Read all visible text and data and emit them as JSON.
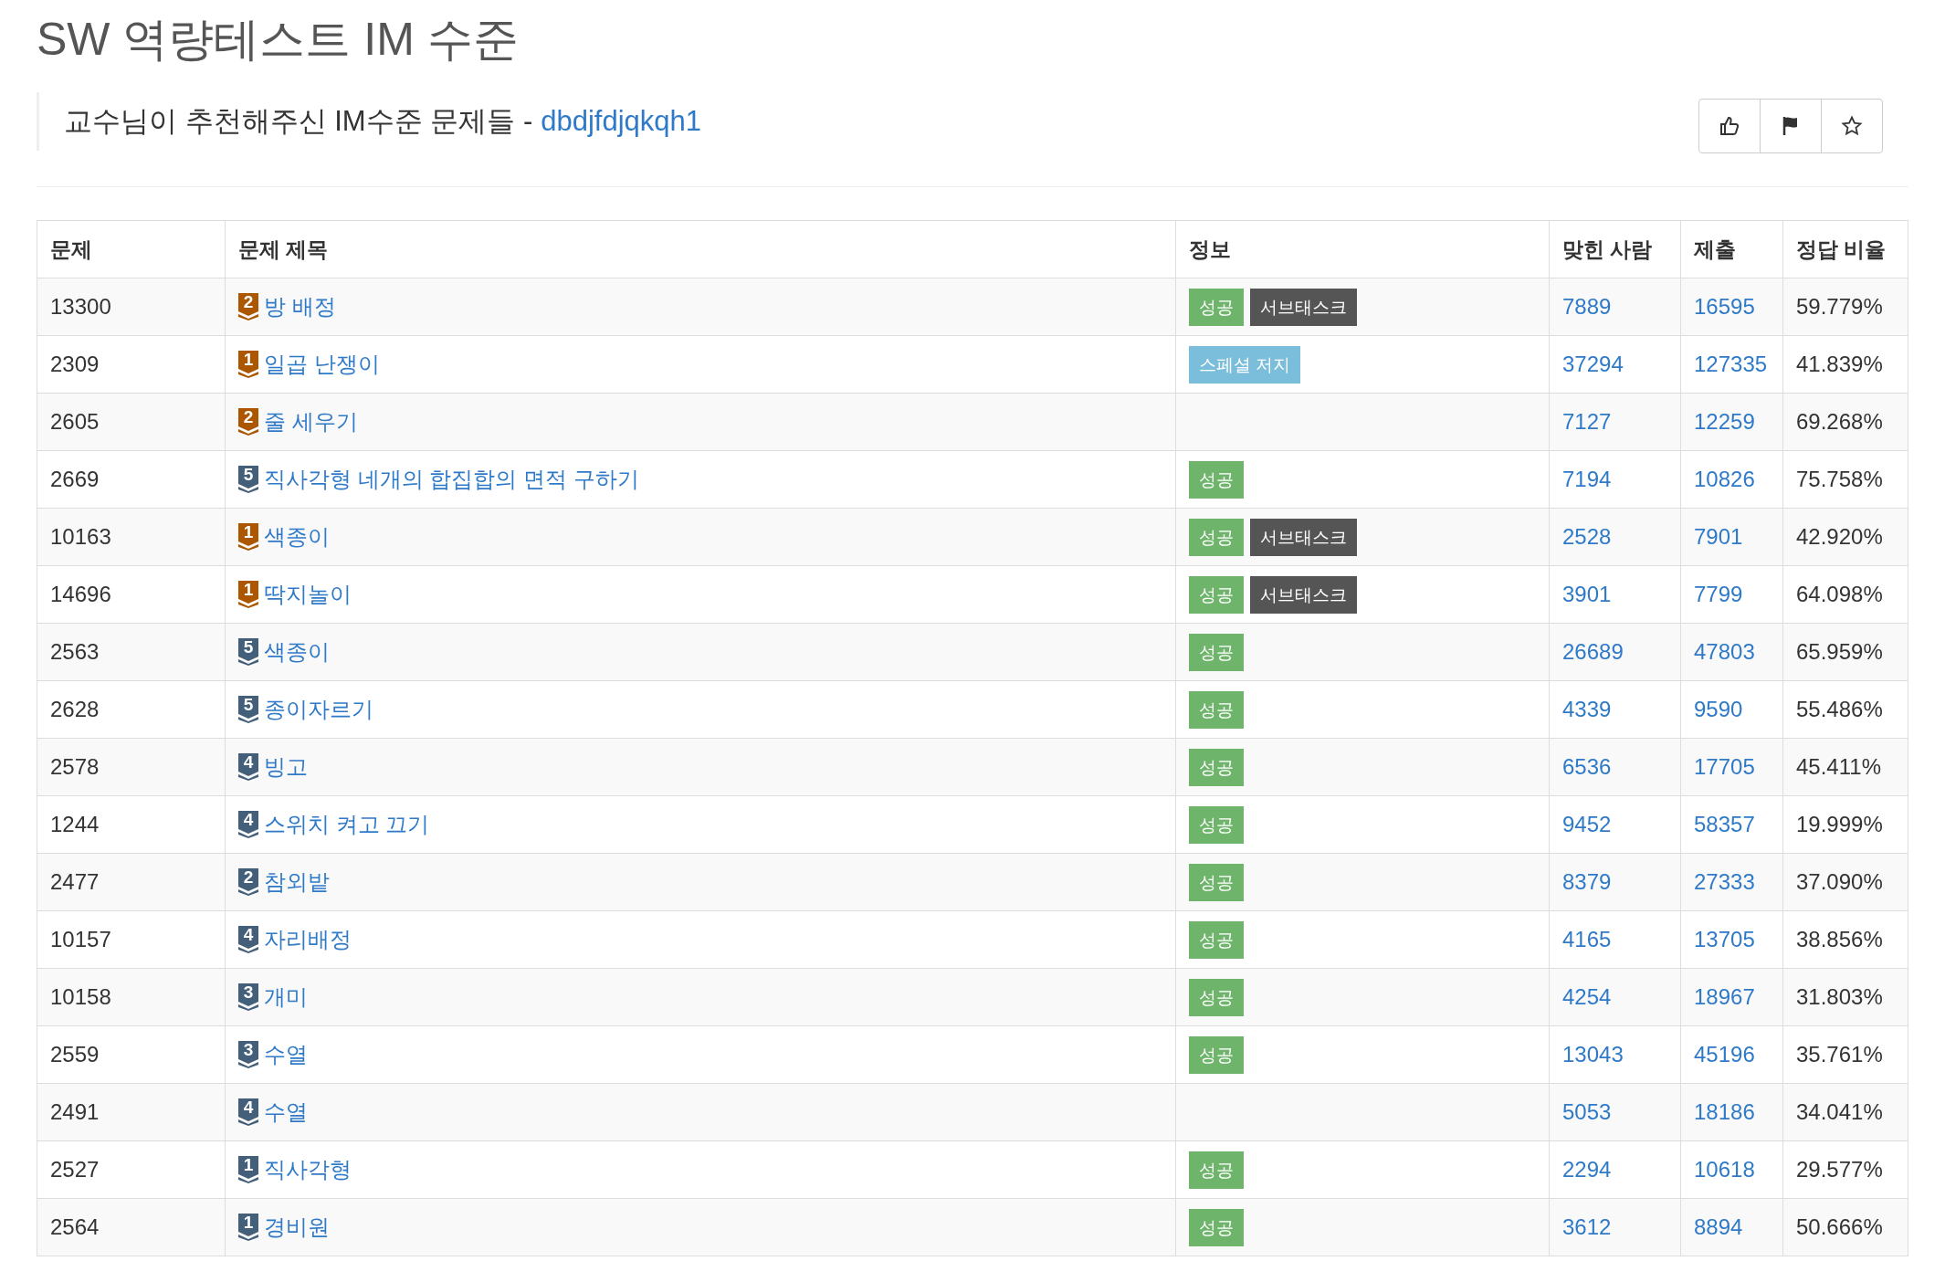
{
  "page": {
    "title": "SW 역량테스트 IM 수준",
    "description": "교수님이 추천해주신 IM수준 문제들 -",
    "author": "dbdjfdjqkqh1"
  },
  "table": {
    "columns": [
      "문제",
      "문제 제목",
      "정보",
      "맞힌 사람",
      "제출",
      "정답 비율"
    ],
    "rows": [
      {
        "id": "13300",
        "tier": "2",
        "color": "#ad5600",
        "title": "방 배정",
        "tags": [
          {
            "kind": "solved",
            "label": "성공"
          },
          {
            "kind": "subtask",
            "label": "서브태스크"
          }
        ],
        "solvers": "7889",
        "submissions": "16595",
        "ratio": "59.779%"
      },
      {
        "id": "2309",
        "tier": "1",
        "color": "#ad5600",
        "title": "일곱 난쟁이",
        "tags": [
          {
            "kind": "special",
            "label": "스페셜 저지"
          }
        ],
        "solvers": "37294",
        "submissions": "127335",
        "ratio": "41.839%"
      },
      {
        "id": "2605",
        "tier": "2",
        "color": "#ad5600",
        "title": "줄 세우기",
        "tags": [],
        "solvers": "7127",
        "submissions": "12259",
        "ratio": "69.268%"
      },
      {
        "id": "2669",
        "tier": "5",
        "color": "#435f7a",
        "title": "직사각형 네개의 합집합의 면적 구하기",
        "tags": [
          {
            "kind": "solved",
            "label": "성공"
          }
        ],
        "solvers": "7194",
        "submissions": "10826",
        "ratio": "75.758%"
      },
      {
        "id": "10163",
        "tier": "1",
        "color": "#ad5600",
        "title": "색종이",
        "tags": [
          {
            "kind": "solved",
            "label": "성공"
          },
          {
            "kind": "subtask",
            "label": "서브태스크"
          }
        ],
        "solvers": "2528",
        "submissions": "7901",
        "ratio": "42.920%"
      },
      {
        "id": "14696",
        "tier": "1",
        "color": "#ad5600",
        "title": "딱지놀이",
        "tags": [
          {
            "kind": "solved",
            "label": "성공"
          },
          {
            "kind": "subtask",
            "label": "서브태스크"
          }
        ],
        "solvers": "3901",
        "submissions": "7799",
        "ratio": "64.098%"
      },
      {
        "id": "2563",
        "tier": "5",
        "color": "#435f7a",
        "title": "색종이",
        "tags": [
          {
            "kind": "solved",
            "label": "성공"
          }
        ],
        "solvers": "26689",
        "submissions": "47803",
        "ratio": "65.959%"
      },
      {
        "id": "2628",
        "tier": "5",
        "color": "#435f7a",
        "title": "종이자르기",
        "tags": [
          {
            "kind": "solved",
            "label": "성공"
          }
        ],
        "solvers": "4339",
        "submissions": "9590",
        "ratio": "55.486%"
      },
      {
        "id": "2578",
        "tier": "4",
        "color": "#435f7a",
        "title": "빙고",
        "tags": [
          {
            "kind": "solved",
            "label": "성공"
          }
        ],
        "solvers": "6536",
        "submissions": "17705",
        "ratio": "45.411%"
      },
      {
        "id": "1244",
        "tier": "4",
        "color": "#435f7a",
        "title": "스위치 켜고 끄기",
        "tags": [
          {
            "kind": "solved",
            "label": "성공"
          }
        ],
        "solvers": "9452",
        "submissions": "58357",
        "ratio": "19.999%"
      },
      {
        "id": "2477",
        "tier": "2",
        "color": "#435f7a",
        "title": "참외밭",
        "tags": [
          {
            "kind": "solved",
            "label": "성공"
          }
        ],
        "solvers": "8379",
        "submissions": "27333",
        "ratio": "37.090%"
      },
      {
        "id": "10157",
        "tier": "4",
        "color": "#435f7a",
        "title": "자리배정",
        "tags": [
          {
            "kind": "solved",
            "label": "성공"
          }
        ],
        "solvers": "4165",
        "submissions": "13705",
        "ratio": "38.856%"
      },
      {
        "id": "10158",
        "tier": "3",
        "color": "#435f7a",
        "title": "개미",
        "tags": [
          {
            "kind": "solved",
            "label": "성공"
          }
        ],
        "solvers": "4254",
        "submissions": "18967",
        "ratio": "31.803%"
      },
      {
        "id": "2559",
        "tier": "3",
        "color": "#435f7a",
        "title": "수열",
        "tags": [
          {
            "kind": "solved",
            "label": "성공"
          }
        ],
        "solvers": "13043",
        "submissions": "45196",
        "ratio": "35.761%"
      },
      {
        "id": "2491",
        "tier": "4",
        "color": "#435f7a",
        "title": "수열",
        "tags": [],
        "solvers": "5053",
        "submissions": "18186",
        "ratio": "34.041%"
      },
      {
        "id": "2527",
        "tier": "1",
        "color": "#435f7a",
        "title": "직사각형",
        "tags": [
          {
            "kind": "solved",
            "label": "성공"
          }
        ],
        "solvers": "2294",
        "submissions": "10618",
        "ratio": "29.577%"
      },
      {
        "id": "2564",
        "tier": "1",
        "color": "#435f7a",
        "title": "경비원",
        "tags": [
          {
            "kind": "solved",
            "label": "성공"
          }
        ],
        "solvers": "3612",
        "submissions": "8894",
        "ratio": "50.666%"
      }
    ]
  }
}
